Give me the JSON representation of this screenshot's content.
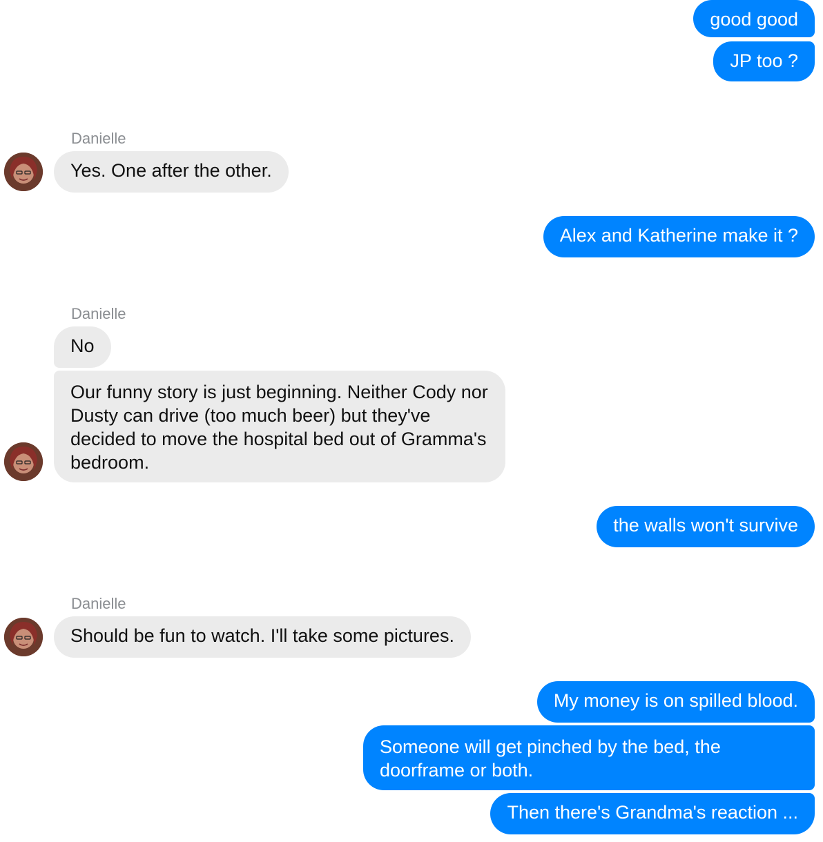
{
  "conversation": {
    "contact_name": "Danielle",
    "colors": {
      "outgoing_bubble": "#0084ff",
      "incoming_bubble": "#ebebeb",
      "sender_label": "#8a8d91"
    },
    "messages": [
      {
        "from": "me",
        "text": "good good"
      },
      {
        "from": "me",
        "text": "JP too ?"
      },
      {
        "from": "Danielle",
        "text": "Yes. One after the other."
      },
      {
        "from": "me",
        "text": "Alex and Katherine make it ?"
      },
      {
        "from": "Danielle",
        "text": "No"
      },
      {
        "from": "Danielle",
        "text": "Our funny story is just beginning. Neither Cody nor Dusty can drive (too much beer) but they've decided to move the hospital bed out of Gramma's bedroom."
      },
      {
        "from": "me",
        "text": "the walls won't survive"
      },
      {
        "from": "Danielle",
        "text": "Should be fun to watch. I'll take some pictures."
      },
      {
        "from": "me",
        "text": "My money is on spilled blood."
      },
      {
        "from": "me",
        "text": "Someone will get pinched by the bed, the doorframe or both."
      },
      {
        "from": "me",
        "text": "Then there's Grandma's reaction ..."
      }
    ]
  }
}
